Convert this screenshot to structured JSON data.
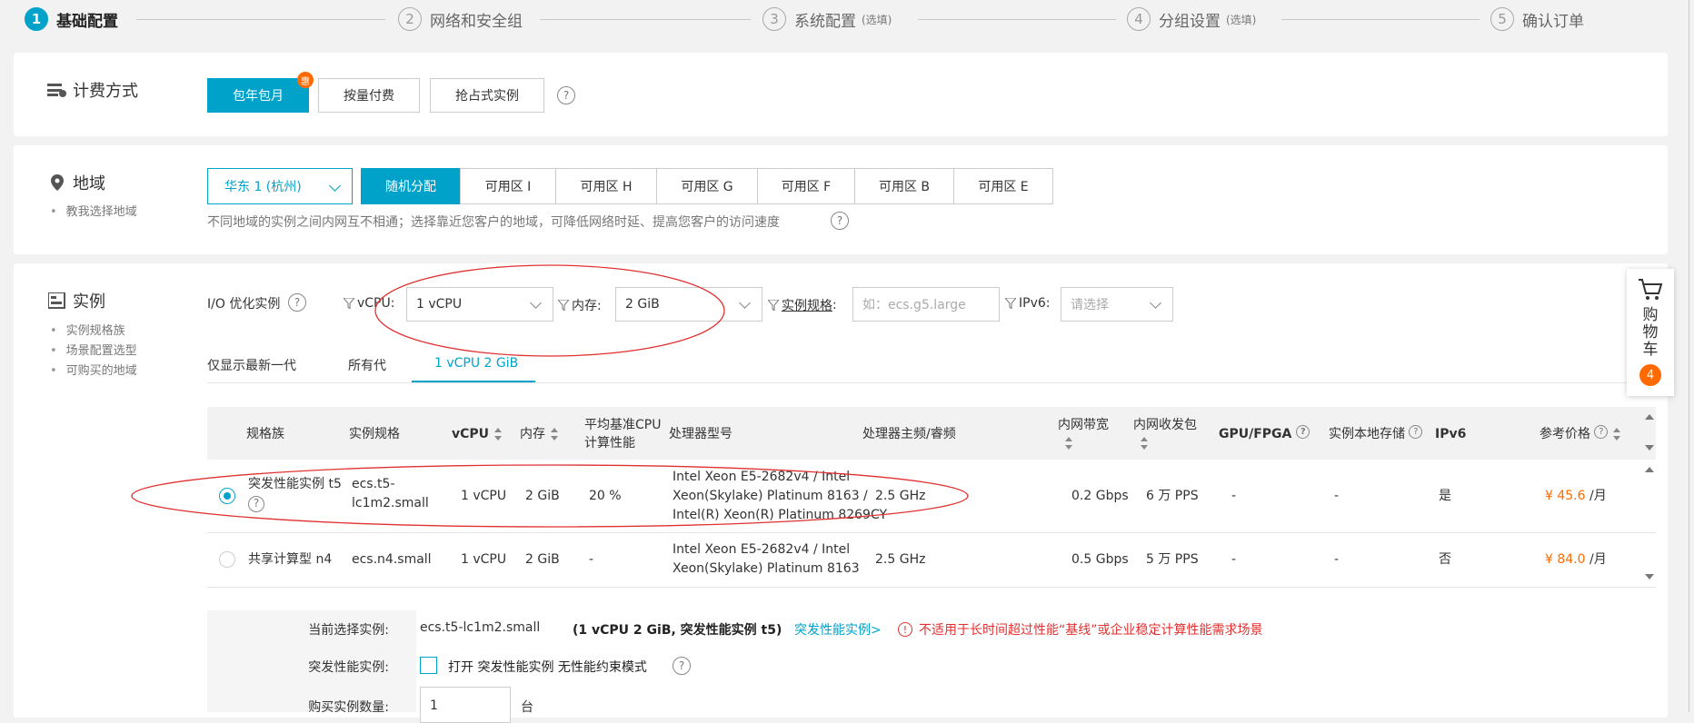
{
  "steps": [
    {
      "num": "1",
      "label": "基础配置",
      "opt": ""
    },
    {
      "num": "2",
      "label": "网络和安全组",
      "opt": ""
    },
    {
      "num": "3",
      "label": "系统配置",
      "opt": "(选填)"
    },
    {
      "num": "4",
      "label": "分组设置",
      "opt": "(选填)"
    },
    {
      "num": "5",
      "label": "确认订单",
      "opt": ""
    }
  ],
  "billing": {
    "title": "计费方式",
    "options": [
      "包年包月",
      "按量付费",
      "抢占式实例"
    ],
    "hui_badge": "惠",
    "help": "?"
  },
  "region": {
    "title": "地域",
    "link": "教我选择地域",
    "selected": "华东 1 (杭州)",
    "zones": [
      "随机分配",
      "可用区 I",
      "可用区 H",
      "可用区 G",
      "可用区 F",
      "可用区 B",
      "可用区 E"
    ],
    "note": "不同地域的实例之间内网互不相通；选择靠近您客户的地域，可降低网络时延、提高您客户的访问速度",
    "help": "?"
  },
  "instance": {
    "title": "实例",
    "links": [
      "实例规格族",
      "场景配置选型",
      "可购买的地域"
    ],
    "io_label": "I/O 优化实例",
    "vcpu_label": "vCPU:",
    "vcpu_value": "1 vCPU",
    "mem_label": "内存:",
    "mem_value": "2 GiB",
    "spec_label": "实例规格",
    "spec_colon": ":",
    "spec_placeholder": "如：ecs.g5.large",
    "ipv6_label": "IPv6:",
    "ipv6_placeholder": "请选择",
    "tabs": [
      "仅显示最新一代",
      "所有代",
      "1 vCPU 2 GiB"
    ],
    "columns": [
      "规格族",
      "实例规格",
      "vCPU",
      "内存",
      "平均基准CPU",
      "计算性能",
      "处理器型号",
      "处理器主频/睿频",
      "内网带宽",
      "内网收发包",
      "GPU/FPGA",
      "实例本地存储",
      "IPv6",
      "参考价格"
    ],
    "rows": [
      {
        "family": "突发性能实例 t5",
        "spec": "ecs.t5-",
        "spec2": "lc1m2.small",
        "vcpu": "1 vCPU",
        "mem": "2 GiB",
        "baseline": "20 %",
        "cpu1": "Intel Xeon E5-2682v4 / Intel",
        "cpu2": "Xeon(Skylake) Platinum 8163 /",
        "cpu3": "Intel(R) Xeon(R) Platinum 8269CY",
        "freq": "2.5 GHz",
        "bw": "0.2 Gbps",
        "pps": "6 万 PPS",
        "gpu": "-",
        "storage": "-",
        "ipv6": "是",
        "price": "¥ 45.6",
        "unit": "/月",
        "selected": true
      },
      {
        "family": "共享计算型 n4",
        "spec": "ecs.n4.small",
        "vcpu": "1 vCPU",
        "mem": "2 GiB",
        "baseline": "-",
        "cpu1": "Intel Xeon E5-2682v4 / Intel",
        "cpu2": "Xeon(Skylake) Platinum 8163",
        "freq": "2.5 GHz",
        "bw": "0.5 Gbps",
        "pps": "5 万 PPS",
        "gpu": "-",
        "storage": "-",
        "ipv6": "否",
        "price": "¥ 84.0",
        "unit": "/月",
        "selected": false
      }
    ],
    "summary": {
      "current_label": "当前选择实例:",
      "current_value": "ecs.t5-lc1m2.small",
      "current_detail": "(1 vCPU 2 GiB, 突发性能实例 t5)",
      "current_link": "突发性能实例>",
      "warning": "不适用于长时间超过性能“基线”或企业稳定计算性能需求场景",
      "burst_label": "突发性能实例:",
      "burst_checkbox": "打开 突发性能实例 无性能约束模式",
      "qty_label": "购买实例数量:",
      "qty_value": "1",
      "qty_unit": "台"
    }
  },
  "cart": {
    "label": "购物车",
    "l1": "购",
    "l2": "物",
    "l3": "车",
    "count": "4"
  },
  "colors": {
    "accent": "#00a2ca",
    "price": "#ff6a00",
    "annotation": "#e03030"
  }
}
